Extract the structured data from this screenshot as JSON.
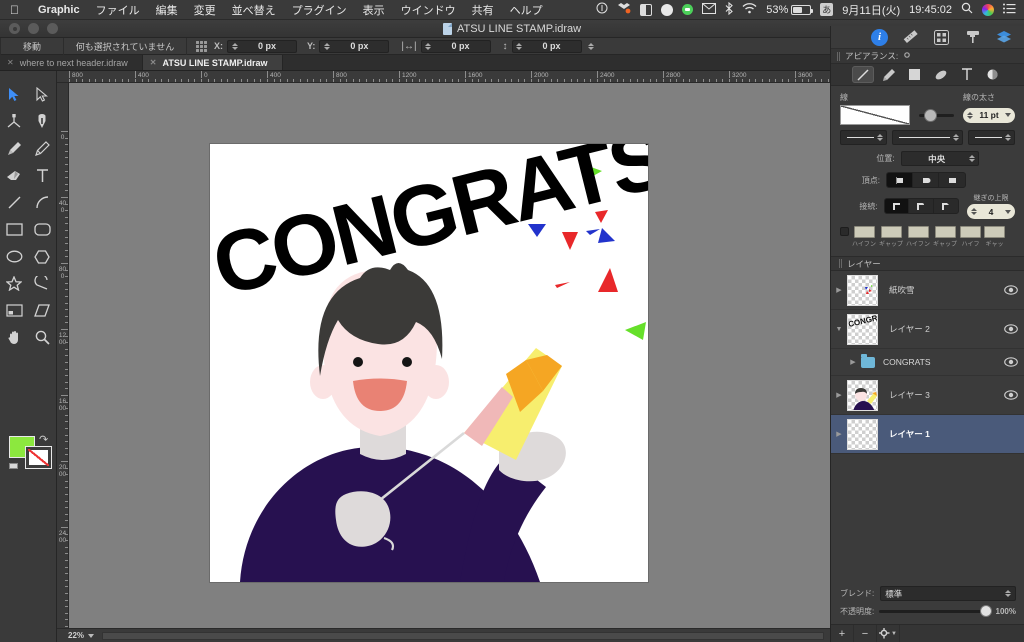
{
  "menubar": {
    "apple_icon": "apple-logo-icon",
    "app_name": "Graphic",
    "items": [
      "ファイル",
      "編集",
      "変更",
      "並べ替え",
      "プラグイン",
      "表示",
      "ウインドウ",
      "共有",
      "ヘルプ"
    ],
    "status": {
      "battery_percent": "53%",
      "date": "9月11日(火)",
      "time": "19:45:02"
    }
  },
  "titlebar": {
    "document": "ATSU LINE STAMP.idraw"
  },
  "options_bar": {
    "tool_mode": "移動",
    "selection_status": "何も選択されていません",
    "fields": [
      {
        "label": "X:",
        "value": "0 px"
      },
      {
        "label": "Y:",
        "value": "0 px"
      },
      {
        "label": "width-icon",
        "value": "0 px"
      },
      {
        "label": "height-icon",
        "value": "0 px"
      }
    ]
  },
  "tabs": [
    {
      "label": "where to next header.idraw",
      "active": false
    },
    {
      "label": "ATSU LINE STAMP.idraw",
      "active": true
    }
  ],
  "toolbox": {
    "tools": [
      "pointer-select-icon",
      "direct-select-icon",
      "node-edit-icon",
      "pen-icon",
      "brush-icon",
      "pencil-icon",
      "eraser-icon",
      "text-icon",
      "line-icon",
      "arc-icon",
      "rectangle-icon",
      "rounded-rectangle-icon",
      "ellipse-icon",
      "polygon-icon",
      "star-icon",
      "spiral-icon",
      "crop-icon",
      "shear-icon",
      "hand-icon",
      "zoom-icon"
    ],
    "fill_color": "#8ce83e",
    "stroke_color": "#ffffff"
  },
  "rulers": {
    "horizontal": [
      "800",
      "400",
      "0",
      "400",
      "800",
      "1200",
      "1600",
      "2000",
      "2400",
      "2800",
      "3200",
      "3600"
    ],
    "vertical": [
      "0",
      "400",
      "800",
      "1200",
      "1600",
      "2000",
      "2400"
    ]
  },
  "statusbar": {
    "zoom_level": "22%"
  },
  "right_panel": {
    "top_icons": [
      "info-icon",
      "ruler-icon",
      "align-icon",
      "paint-roller-icon",
      "layers-icon"
    ],
    "appearance": {
      "header": "アピアランス:",
      "header_icon": "gear-icon",
      "tabs": [
        "stroke-icon",
        "brush-icon",
        "fill-icon",
        "shadow-icon",
        "text-icon",
        "blur-icon"
      ]
    },
    "stroke": {
      "section_label": "線",
      "width_label": "線の太さ",
      "width_value": "11 pt",
      "position_label": "位置:",
      "position_value": "中央",
      "cap_label": "頂点:",
      "join_label": "接続:",
      "miter_label": "継ぎの上限",
      "miter_value": "4",
      "dash_labels": [
        "ハイフン",
        "ギャップ",
        "ハイフン",
        "ギャップ",
        "ハイフ",
        "ギャッ"
      ]
    },
    "layers": {
      "header": "レイヤー",
      "rows": [
        {
          "name": "紙吹雪",
          "type": "layer",
          "expanded": false,
          "visible": true,
          "selected": false,
          "thumb": "confetti"
        },
        {
          "name": "レイヤー 2",
          "type": "layer",
          "expanded": true,
          "visible": true,
          "selected": false,
          "thumb": "congrats"
        },
        {
          "name": "CONGRATS",
          "type": "group",
          "expanded": false,
          "visible": true,
          "selected": false
        },
        {
          "name": "レイヤー 3",
          "type": "layer",
          "expanded": false,
          "visible": true,
          "selected": false,
          "thumb": "character"
        },
        {
          "name": "レイヤー 1",
          "type": "layer",
          "expanded": false,
          "visible": false,
          "selected": true,
          "thumb": "empty"
        }
      ]
    },
    "footer": {
      "blend_label": "ブレンド:",
      "blend_value": "標準",
      "opacity_label": "不透明度:",
      "opacity_value": "100%",
      "add_label": "+",
      "remove_label": "−",
      "settings_icon": "gear-icon"
    }
  },
  "artwork": {
    "title_text": "CONGRATS!",
    "colors": {
      "hair": "#3b3a38",
      "skin": "#fbe3e3",
      "shirt": "#271150",
      "mouth": "#e98274",
      "hand": "#dedada",
      "popper_orange": "#f5a623",
      "popper_yellow": "#f7ee6e",
      "popper_pink": "#f0b8b8",
      "confetti_red": "#e8282a",
      "confetti_blue": "#2233cc",
      "confetti_green": "#66e02a"
    }
  }
}
